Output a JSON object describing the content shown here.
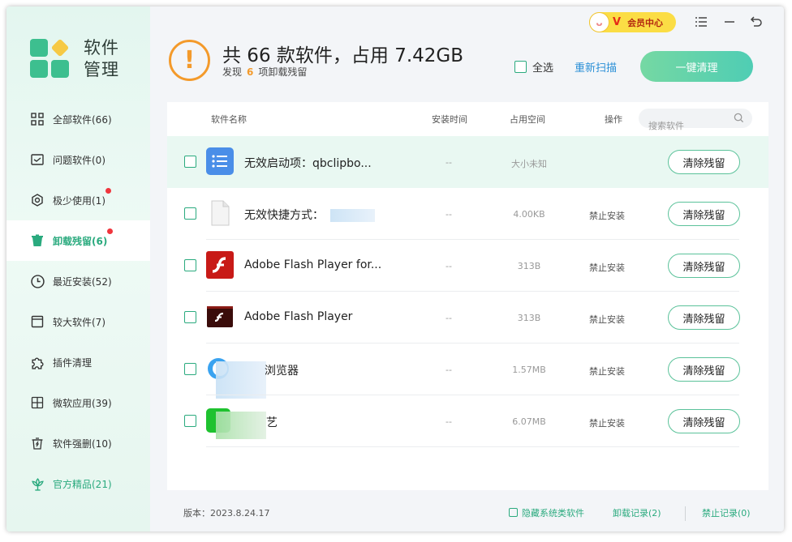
{
  "brand": {
    "line1": "软件",
    "line2": "管理"
  },
  "sidebar": {
    "items": [
      {
        "label": "全部软件(66)",
        "icon": "grid-icon"
      },
      {
        "label": "问题软件(0)",
        "icon": "warning-box-icon"
      },
      {
        "label": "极少使用(1)",
        "icon": "hexagon-icon",
        "dot": true
      },
      {
        "label": "卸载残留(6)",
        "icon": "trash-icon",
        "dot": true,
        "active": true
      },
      {
        "label": "最近安装(52)",
        "icon": "clock-icon"
      },
      {
        "label": "较大软件(7)",
        "icon": "box-icon"
      },
      {
        "label": "插件清理",
        "icon": "puzzle-icon"
      },
      {
        "label": "微软应用(39)",
        "icon": "windows-icon"
      },
      {
        "label": "软件强删(10)",
        "icon": "force-delete-icon"
      },
      {
        "label": "官方精品(21)",
        "icon": "lotus-icon",
        "green": true
      }
    ]
  },
  "header": {
    "title": "共 66 款软件，占用 7.42GB",
    "subtitle_prefix": "发现",
    "subtitle_count": "6",
    "subtitle_suffix": "项卸载残留",
    "select_all": "全选",
    "rescan": "重新扫描",
    "clean_button": "一键清理",
    "vip_label": "会员中心"
  },
  "table": {
    "columns": {
      "name": "软件名称",
      "time": "安装时间",
      "size": "占用空间",
      "op": "操作"
    },
    "search_placeholder": "搜索软件",
    "rows": [
      {
        "name": "无效启动项：qbclipbo...",
        "time": "--",
        "size": "大小未知",
        "op": "",
        "action": "清除残留",
        "icon": "list-app-icon"
      },
      {
        "name": "无效快捷方式：",
        "time": "--",
        "size": "4.00KB",
        "op": "禁止安装",
        "action": "清除残留",
        "icon": "file-icon"
      },
      {
        "name": "Adobe Flash Player for...",
        "time": "--",
        "size": "313B",
        "op": "禁止安装",
        "action": "清除残留",
        "icon": "flash-icon"
      },
      {
        "name": "Adobe Flash Player",
        "time": "--",
        "size": "313B",
        "op": "禁止安装",
        "action": "清除残留",
        "icon": "flash-dark-icon"
      },
      {
        "name": "浏览器",
        "time": "--",
        "size": "1.57MB",
        "op": "禁止安装",
        "action": "清除残留",
        "icon": "browser-icon"
      },
      {
        "name": "艺",
        "time": "--",
        "size": "6.07MB",
        "op": "禁止安装",
        "action": "清除残留",
        "icon": "video-app-icon"
      }
    ]
  },
  "footer": {
    "version": "版本：2023.8.24.17",
    "hide_system": "隐藏系统类软件",
    "uninstall_log": "卸载记录(2)",
    "block_log": "禁止记录(0)"
  },
  "colors": {
    "accent": "#2aaa7e",
    "warning": "#f39a2b",
    "link": "#2a8fd6"
  }
}
